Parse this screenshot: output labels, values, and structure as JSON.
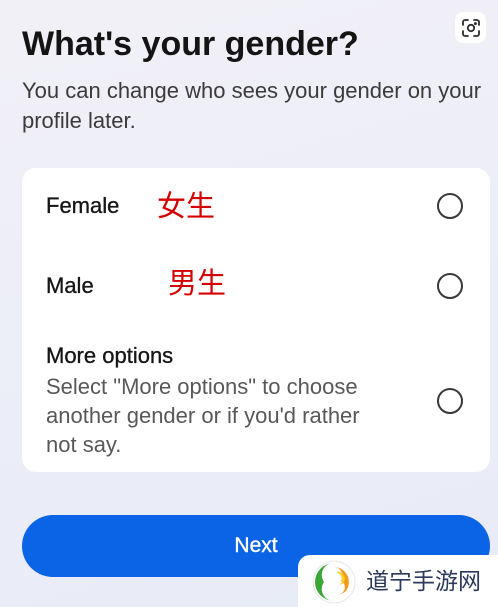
{
  "header": {
    "title": "What's your gender?",
    "subtitle": "You can change who sees your gender on your profile later."
  },
  "icons": {
    "lens": "lens-scan-icon",
    "radio": "radio-circle-icon",
    "watermark_logo": "swirl-logo-icon"
  },
  "options": [
    {
      "label": "Female",
      "annotation": "女生",
      "selected": false
    },
    {
      "label": "Male",
      "annotation": "男生",
      "selected": false
    },
    {
      "label": "More options",
      "description": "Select \"More options\" to choose another gender or if you'd rather not say.",
      "selected": false
    }
  ],
  "next_button": {
    "label": "Next"
  },
  "watermark": {
    "text": "道宁手游网"
  },
  "colors": {
    "accent": "#0b63e5",
    "annotation": "#d40000",
    "background": "#eef0f8"
  }
}
